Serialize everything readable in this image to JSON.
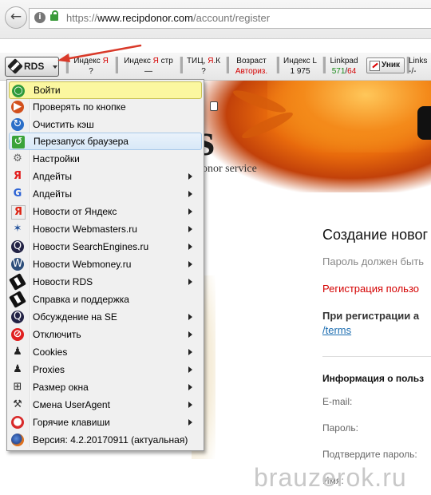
{
  "address_bar": {
    "url_scheme": "https://",
    "url_host": "www.recipdonor.com",
    "url_path": "/account/register",
    "back_icon": "back-arrow-icon",
    "info_icon": "info-icon",
    "lock_icon": "lock-icon"
  },
  "rds_toolbar": {
    "button_label": "RDS",
    "metrics": [
      {
        "label": "Индекс ",
        "label_red": "Я",
        "value": "?"
      },
      {
        "label": "Индекс ",
        "label_red": "Я",
        "label_after": " стр",
        "value": "—"
      },
      {
        "label": "ТИЦ, ",
        "label_red": "Я",
        "label_after": ".К",
        "value": "?"
      },
      {
        "label": "Возраст",
        "value": "Авториз."
      },
      {
        "label": "Индекс L",
        "value": "1 975"
      },
      {
        "label": "Linkpad",
        "value_green": "571",
        "value_sep": "/",
        "value_red": "64"
      },
      {
        "label": "Links",
        "value": "-/-"
      }
    ],
    "unik_label": "Уник"
  },
  "menu": {
    "items": [
      {
        "label": "Войти",
        "icon": "login-key-icon",
        "submenu": false
      },
      {
        "label": "Проверять по кнопке",
        "icon": "check-on-button-icon",
        "submenu": false
      },
      {
        "label": "Очистить кэш",
        "icon": "clear-cache-icon",
        "submenu": false
      },
      {
        "label": "Перезапуск браузера",
        "icon": "restart-icon",
        "submenu": false
      },
      {
        "label": "Настройки",
        "icon": "gear-icon",
        "submenu": false
      },
      {
        "label": "Апдейты",
        "icon": "yandex-icon",
        "submenu": true
      },
      {
        "label": "Апдейты",
        "icon": "google-icon",
        "submenu": true
      },
      {
        "label": "Новости от Яндекс",
        "icon": "yandex-news-icon",
        "submenu": true
      },
      {
        "label": "Новости Webmasters.ru",
        "icon": "star-icon",
        "submenu": true
      },
      {
        "label": "Новости SearchEngines.ru",
        "icon": "searchengines-icon",
        "submenu": true
      },
      {
        "label": "Новости Webmoney.ru",
        "icon": "webmoney-icon",
        "submenu": true
      },
      {
        "label": "Новости RDS",
        "icon": "rds-icon",
        "submenu": true
      },
      {
        "label": "Справка и поддержка",
        "icon": "rds-help-icon",
        "submenu": false
      },
      {
        "label": "Обсуждение на SE",
        "icon": "se-forum-icon",
        "submenu": true
      },
      {
        "label": "Отключить",
        "icon": "disable-icon",
        "submenu": true
      },
      {
        "label": "Cookies",
        "icon": "user-icon",
        "submenu": true
      },
      {
        "label": "Proxies",
        "icon": "user-icon",
        "submenu": true
      },
      {
        "label": "Размер окна",
        "icon": "crop-icon",
        "submenu": true
      },
      {
        "label": "Смена UserAgent",
        "icon": "robot-icon",
        "submenu": true
      },
      {
        "label": "Горячие клавиши",
        "icon": "red-button-icon",
        "submenu": true
      },
      {
        "label": "Версия: 4.2.20170911 (актуальная)",
        "icon": "firefox-icon",
        "submenu": false
      }
    ]
  },
  "page": {
    "logo_fragment": "s",
    "tagline_fragment": "onor service",
    "form_title": "Создание новог",
    "password_hint": "Пароль должен быть",
    "registration_notice": "Регистрация пользо",
    "terms_intro": "При регистрации а",
    "terms_link": "/terms",
    "user_info_heading": "Информация о польз",
    "email_label": "E-mail:",
    "password_label": "Пароль:",
    "confirm_label": "Подтвердите пароль:",
    "name_label": "Имя:"
  },
  "watermark": "brauzerok.ru",
  "colors": {
    "menu_highlight": "#fbf7a0",
    "menu_hover": "#d8e8f7",
    "yandex_red": "#d40000",
    "linkpad_green": "#1a8a1a",
    "splash_orange": "#e86a0c",
    "link_blue": "#1a6cb0",
    "annotation_arrow": "#d93a2a"
  }
}
